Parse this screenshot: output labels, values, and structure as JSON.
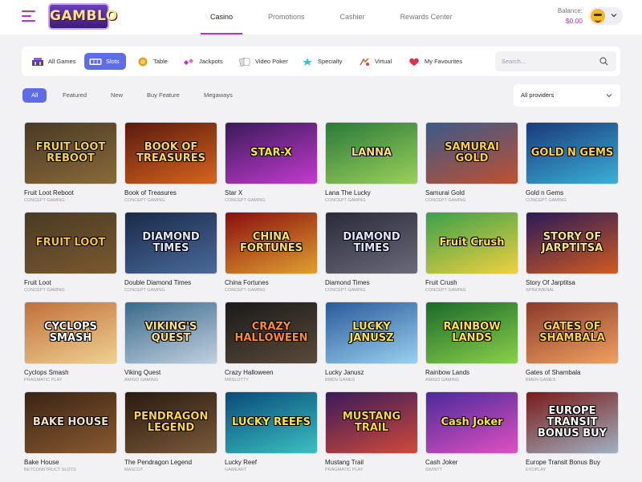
{
  "header": {
    "logo_text": "GAMBLO",
    "nav": [
      {
        "label": "Casino",
        "active": true
      },
      {
        "label": "Promotions",
        "active": false
      },
      {
        "label": "Cashier",
        "active": false
      },
      {
        "label": "Rewards Center",
        "active": false
      }
    ],
    "balance_label": "Balance:",
    "balance_value": "$0.00",
    "accent_color": "#c22cc9"
  },
  "categories": [
    {
      "label": "All Games",
      "icon": "casino-building-icon",
      "active": false
    },
    {
      "label": "Slots",
      "icon": "slot-reels-icon",
      "active": true
    },
    {
      "label": "Table",
      "icon": "chip-icon",
      "active": false
    },
    {
      "label": "Jackpots",
      "icon": "sparkle-gems-icon",
      "active": false
    },
    {
      "label": "Video Poker",
      "icon": "cards-icon",
      "active": false
    },
    {
      "label": "Specialty",
      "icon": "specialty-star-icon",
      "active": false
    },
    {
      "label": "Virtual",
      "icon": "virtual-sports-icon",
      "active": false
    },
    {
      "label": "My Favourites",
      "icon": "heart-icon",
      "active": false
    }
  ],
  "search": {
    "placeholder": "Search..."
  },
  "filters": [
    {
      "label": "All",
      "active": true
    },
    {
      "label": "Featured",
      "active": false
    },
    {
      "label": "New",
      "active": false
    },
    {
      "label": "Buy Feature",
      "active": false
    },
    {
      "label": "Megaways",
      "active": false
    }
  ],
  "providers_select": {
    "selected": "All providers"
  },
  "games": [
    {
      "name": "Fruit Loot Reboot",
      "provider": "CONCEPT GAMING",
      "art": "FRUIT LOOT REBOOT",
      "bg": [
        "#4a3a24",
        "#8a6a3a"
      ],
      "fg": "#f7d23a"
    },
    {
      "name": "Book of Treasures",
      "provider": "CONCEPT GAMING",
      "art": "BOOK OF TREASURES",
      "bg": [
        "#5a1a0e",
        "#d8641e"
      ],
      "fg": "#ffd35a"
    },
    {
      "name": "Star X",
      "provider": "CONCEPT GAMING",
      "art": "STAR-X",
      "bg": [
        "#3a1a5a",
        "#c43ad0"
      ],
      "fg": "#ffe23a"
    },
    {
      "name": "Lana The Lucky",
      "provider": "CONCEPT GAMING",
      "art": "LANNA",
      "bg": [
        "#2a7a3a",
        "#9ad05a"
      ],
      "fg": "#ffe27a"
    },
    {
      "name": "Samurai Gold",
      "provider": "CONCEPT GAMING",
      "art": "SAMURAI GOLD",
      "bg": [
        "#3a5a8a",
        "#c05030"
      ],
      "fg": "#ffcf3a"
    },
    {
      "name": "Gold n Gems",
      "provider": "CONCEPT GAMING",
      "art": "GOLD N GEMS",
      "bg": [
        "#1a3a7a",
        "#3ab0d8"
      ],
      "fg": "#ffd23a"
    },
    {
      "name": "Fruit Loot",
      "provider": "CONCEPT GAMING",
      "art": "FRUIT LOOT",
      "bg": [
        "#4a3a24",
        "#7a5a30"
      ],
      "fg": "#f7c23a"
    },
    {
      "name": "Double Diamond Times",
      "provider": "CONCEPT GAMING",
      "art": "DIAMOND TIMES",
      "bg": [
        "#1a2a4a",
        "#4a6a9a"
      ],
      "fg": "#dfe8ff"
    },
    {
      "name": "China Fortunes",
      "provider": "CONCEPT GAMING",
      "art": "CHINA FORTUNES",
      "bg": [
        "#8a0e0e",
        "#e0a030"
      ],
      "fg": "#ffe05a"
    },
    {
      "name": "Diamond Times",
      "provider": "CONCEPT GAMING",
      "art": "DIAMOND TIMES",
      "bg": [
        "#2a2a3a",
        "#6a6a7a"
      ],
      "fg": "#dfe8ff"
    },
    {
      "name": "Fruit Crush",
      "provider": "CONCEPT GAMING",
      "art": "Fruit Crush",
      "bg": [
        "#3aa04a",
        "#f0d040"
      ],
      "fg": "#ffe23a"
    },
    {
      "name": "Story Of Jarptitsa",
      "provider": "SPINOMENAL",
      "art": "STORY OF JARPTITSA",
      "bg": [
        "#2a1a5a",
        "#d05a20"
      ],
      "fg": "#ffe27a"
    },
    {
      "name": "Cyclops Smash",
      "provider": "PRAGMATIC PLAY",
      "art": "CYCLOPS SMASH",
      "bg": [
        "#c0703a",
        "#f0d090"
      ],
      "fg": "#ffffff"
    },
    {
      "name": "Viking Quest",
      "provider": "AMIGO GAMING",
      "art": "VIKING'S QUEST",
      "bg": [
        "#3a6a8a",
        "#c0d0e0"
      ],
      "fg": "#ffe27a"
    },
    {
      "name": "Crazy Halloween",
      "provider": "MRSLOTTY",
      "art": "CRAZY HALLOWEEN",
      "bg": [
        "#1a1a1a",
        "#5a4a3a"
      ],
      "fg": "#ff8a2a"
    },
    {
      "name": "Lucky Janusz",
      "provider": "BMEN GAMES",
      "art": "LUCKY JANUSZ",
      "bg": [
        "#2a5a9a",
        "#9ad0f0"
      ],
      "fg": "#ffe23a"
    },
    {
      "name": "Rainbow Lands",
      "provider": "AMIGO GAMING",
      "art": "RAINBOW LANDS",
      "bg": [
        "#1a6a2a",
        "#8ad04a"
      ],
      "fg": "#ffe23a"
    },
    {
      "name": "Gates of Shambala",
      "provider": "BMEN GAMES",
      "art": "GATES OF SHAMBALA",
      "bg": [
        "#8a3a2a",
        "#f0a060"
      ],
      "fg": "#ffd23a"
    },
    {
      "name": "Bake House",
      "provider": "BETCONSTRUCT SLOTS",
      "art": "BAKE HOUSE",
      "bg": [
        "#3a2414",
        "#8a5a30"
      ],
      "fg": "#f0e0c0"
    },
    {
      "name": "The Pendragon Legend",
      "provider": "MASCOT",
      "art": "PENDRAGON LEGEND",
      "bg": [
        "#2a1a10",
        "#7a5a3a"
      ],
      "fg": "#ffd23a"
    },
    {
      "name": "Lucky Reef",
      "provider": "GAMEART",
      "art": "LUCKY REEFS",
      "bg": [
        "#0a4a7a",
        "#3ac0c0"
      ],
      "fg": "#ffe23a"
    },
    {
      "name": "Mustang Trail",
      "provider": "PRAGMATIC PLAY",
      "art": "MUSTANG TRAIL",
      "bg": [
        "#3a1a5a",
        "#d04a3a"
      ],
      "fg": "#ffd23a"
    },
    {
      "name": "Cash Joker",
      "provider": "SWINTT",
      "art": "Cash Joker",
      "bg": [
        "#4a2a9a",
        "#e050c0"
      ],
      "fg": "#ffe23a"
    },
    {
      "name": "Europe Transit Bonus Buy",
      "provider": "EVOPLAY",
      "art": "EUROPE TRANSIT BONUS BUY",
      "bg": [
        "#7a1a1a",
        "#a0b0c0"
      ],
      "fg": "#ffffff"
    }
  ]
}
